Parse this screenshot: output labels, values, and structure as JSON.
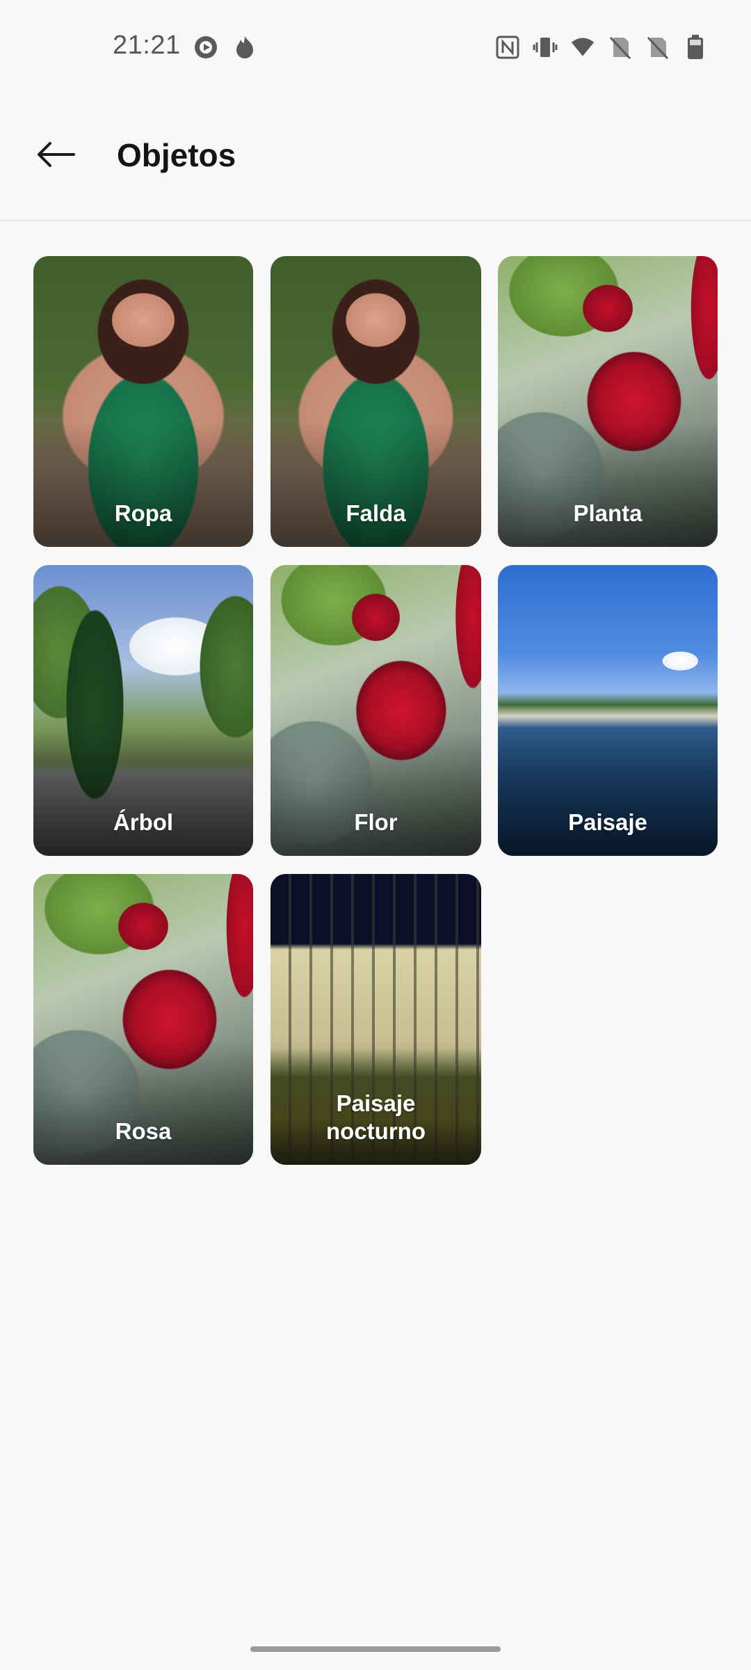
{
  "status_bar": {
    "time": "21:21",
    "left_icons": [
      "play-icon",
      "fire-icon"
    ],
    "right_icons": [
      "nfc-icon",
      "vibrate-icon",
      "wifi-icon",
      "no-sim-icon",
      "no-sim-icon",
      "battery-icon"
    ]
  },
  "app_bar": {
    "back_icon": "arrow-left-icon",
    "title": "Objetos"
  },
  "tiles": [
    {
      "label": "Ropa",
      "image": "woman-green-dress"
    },
    {
      "label": "Falda",
      "image": "woman-green-dress"
    },
    {
      "label": "Planta",
      "image": "red-rose"
    },
    {
      "label": "Árbol",
      "image": "park-trees"
    },
    {
      "label": "Flor",
      "image": "red-rose"
    },
    {
      "label": "Paisaje",
      "image": "lake-monument"
    },
    {
      "label": "Rosa",
      "image": "red-rose"
    },
    {
      "label": "Paisaje\nnocturno",
      "image": "building-night"
    }
  ]
}
